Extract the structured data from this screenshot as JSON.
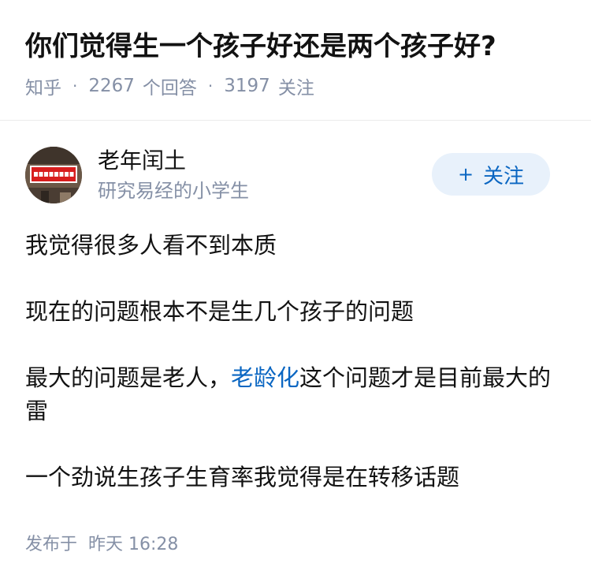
{
  "question": {
    "title": "你们觉得生一个孩子好还是两个孩子好?",
    "source": "知乎",
    "answer_count": "2267",
    "answer_label": "个回答",
    "follower_count": "3197",
    "follower_label": "关注",
    "separator": "·"
  },
  "author": {
    "name": "老年闰土",
    "headline": "研究易经的小学生",
    "follow_plus": "+",
    "follow_label": "关注",
    "avatar_sign_text": "专业解决各种疼痛"
  },
  "answer": {
    "p1": "我觉得很多人看不到本质",
    "p2": "现在的问题根本不是生几个孩子的问题",
    "p3_before": "最大的问题是老人，",
    "p3_link": "老龄化",
    "p3_after": "这个问题才是目前最大的雷",
    "p4": "一个劲说生孩子生育率我觉得是在转移话题"
  },
  "publish": {
    "label": "发布于",
    "time": "昨天 16:28"
  },
  "colors": {
    "text": "#121212",
    "meta": "#8590a6",
    "link": "#0a66c2",
    "follow_bg": "#e8f1fb"
  }
}
